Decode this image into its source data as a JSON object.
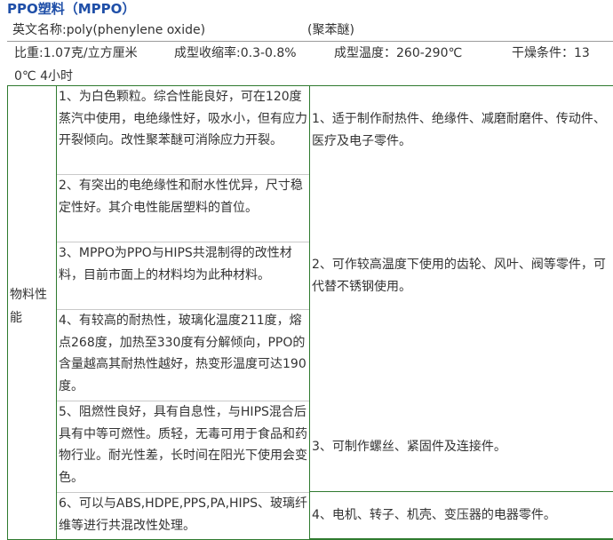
{
  "title": "PPO塑料（MPPO）",
  "names": {
    "english_label": "英文名称:poly(phenylene oxide)",
    "chinese_name": "(聚苯醚)"
  },
  "properties": {
    "density": "比重:1.07克/立方厘米",
    "shrinkage": "成型收缩率:0.3-0.8%",
    "molding_temp": "成型温度：260-290℃",
    "drying_part1": "干燥条件：13",
    "drying_part2": "0℃  4小时"
  },
  "material_section": {
    "label": "物料性能",
    "property_items": [
      "1、为白色颗粒。综合性能良好，可在120度蒸汽中使用，电绝缘性好，吸水小，但有应力开裂倾向。改性聚苯醚可消除应力开裂。",
      "2、有突出的电绝缘性和耐水性优异，尺寸稳定性好。其介电性能居塑料的首位。",
      "3、MPPO为PPO与HIPS共混制得的改性材料，目前市面上的材料均为此种材料。",
      "4、有较高的耐热性，玻璃化温度211度，熔点268度，加热至330度有分解倾向，PPO的含量越高其耐热性越好，热变形温度可达190度。",
      "5、阻燃性良好，具有自息性，与HIPS混合后具有中等可燃性。质轻，无毒可用于食品和药物行业。耐光性差，长时间在阳光下使用会变色。",
      "6、可以与ABS,HDPE,PPS,PA,HIPS、玻璃纤维等进行共混改性处理。"
    ],
    "application_items": [
      "1、适于制作耐热件、绝缘件、减磨耐磨件、传动件、医疗及电子零件。",
      "2、可作较高温度下使用的齿轮、风叶、阀等零件，可代替不锈钢使用。",
      "3、可制作螺丝、紧固件及连接件。",
      "4、电机、转子、机壳、变压器的电器零件。"
    ]
  }
}
